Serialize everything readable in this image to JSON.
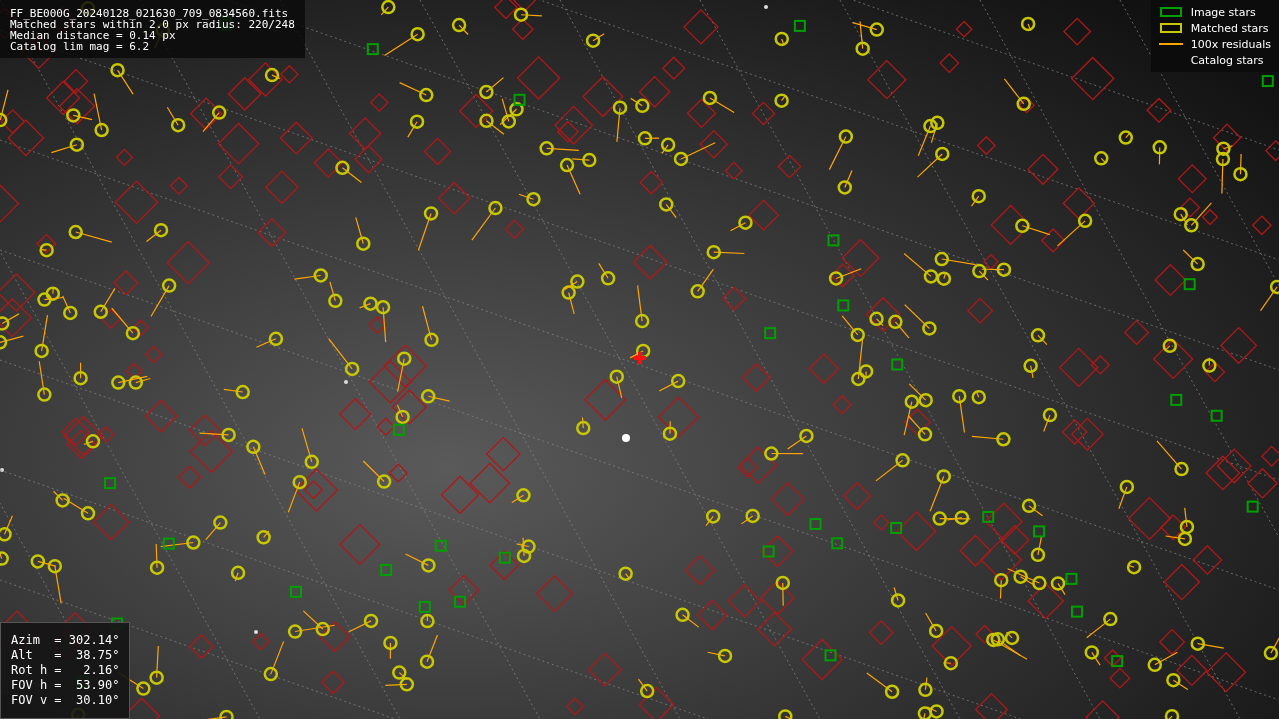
{
  "info_box": {
    "lines": [
      "FF_BE000G_20240128_021630_709_0834560.fits",
      "Matched stars within 2.0 px radius: 220/248",
      "Median distance = 0.14 px",
      "Catalog lim mag = 6.2"
    ]
  },
  "legend": [
    {
      "kind": "image",
      "label": "Image stars"
    },
    {
      "kind": "matched",
      "label": "Matched stars"
    },
    {
      "kind": "residual",
      "label": "100x residuals"
    },
    {
      "kind": "catalog",
      "label": "Catalog stars"
    }
  ],
  "pointing_box": {
    "lines": [
      "Azim  = 302.14°",
      "Alt   =  38.75°",
      "Rot h =   2.16°",
      "FOV h =  53.90°",
      "FOV v =  30.10°"
    ]
  }
}
